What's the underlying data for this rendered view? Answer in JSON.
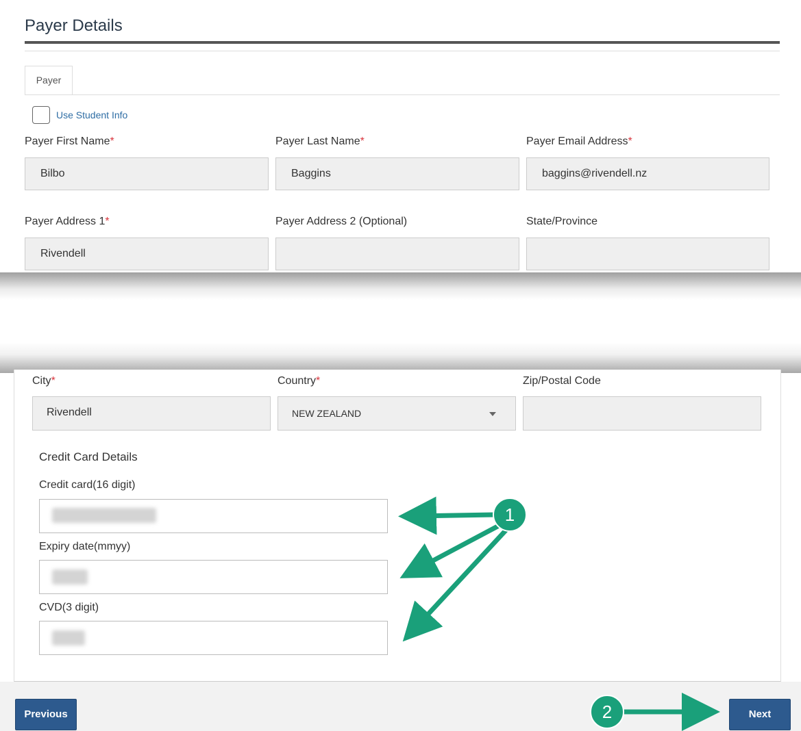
{
  "section": {
    "title": "Payer Details"
  },
  "tabs": [
    {
      "label": "Payer"
    }
  ],
  "use_student_info": {
    "label": "Use Student Info",
    "checked": false
  },
  "fields": {
    "first_name": {
      "label": "Payer First Name",
      "value": "Bilbo",
      "required": "*"
    },
    "last_name": {
      "label": "Payer Last Name",
      "value": "Baggins",
      "required": "*"
    },
    "email": {
      "label": "Payer Email Address",
      "value": "baggins@rivendell.nz",
      "required": "*"
    },
    "address1": {
      "label": "Payer Address 1",
      "value": "Rivendell",
      "required": "*"
    },
    "address2": {
      "label": "Payer Address 2 (Optional)",
      "value": ""
    },
    "state": {
      "label": "State/Province",
      "value": ""
    },
    "city": {
      "label": "City",
      "value": "Rivendell",
      "required": "*"
    },
    "country": {
      "label": "Country",
      "value": "NEW ZEALAND",
      "required": "*"
    },
    "zip": {
      "label": "Zip/Postal Code",
      "value": ""
    }
  },
  "credit_card": {
    "heading": "Credit Card Details",
    "number_label": "Credit card(16 digit)",
    "expiry_label": "Expiry date(mmyy)",
    "cvd_label": "CVD(3 digit)"
  },
  "annotations": {
    "badge1": "1",
    "badge2": "2",
    "color": "#1aa07a"
  },
  "buttons": {
    "previous": "Previous",
    "next": "Next"
  }
}
